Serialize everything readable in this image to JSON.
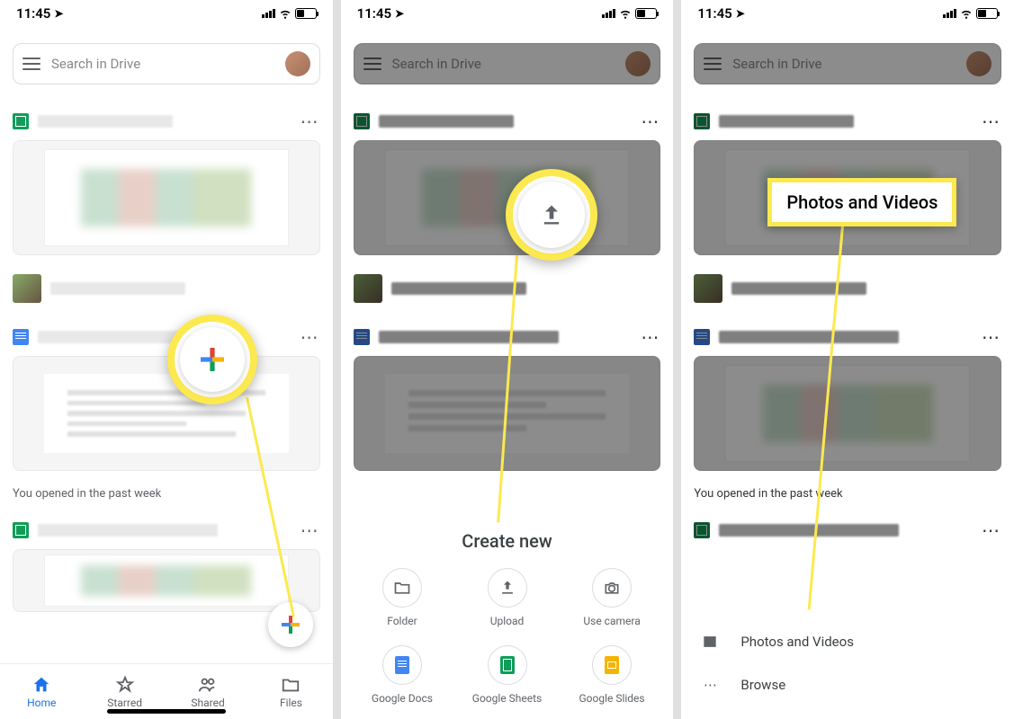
{
  "status": {
    "time": "11:45"
  },
  "search": {
    "placeholder": "Search in Drive"
  },
  "section_label": "You opened in the past week",
  "bottom_nav": {
    "home": "Home",
    "starred": "Starred",
    "shared": "Shared",
    "files": "Files"
  },
  "create_sheet": {
    "title": "Create new",
    "items": {
      "folder": "Folder",
      "upload": "Upload",
      "camera": "Use camera",
      "docs": "Google Docs",
      "sheets": "Google Sheets",
      "slides": "Google Slides"
    }
  },
  "upload_sheet": {
    "photos": "Photos and Videos",
    "browse": "Browse"
  },
  "callouts": {
    "photos": "Photos and Videos"
  }
}
